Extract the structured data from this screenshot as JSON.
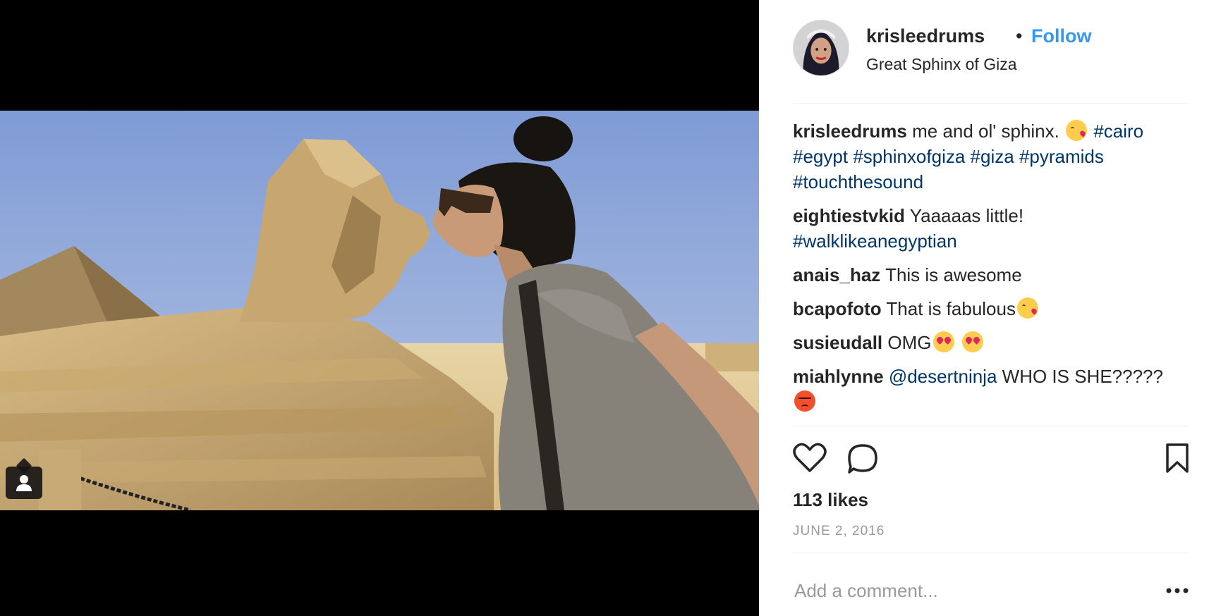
{
  "post": {
    "username": "krisleedrums",
    "separator": "•",
    "follow_label": "Follow",
    "location": "Great Sphinx of Giza",
    "likes": "113 likes",
    "date": "JUNE 2, 2016",
    "add_comment_placeholder": "Add a comment...",
    "photo_subject": "woman kissing the Great Sphinx with pyramid in background"
  },
  "caption": {
    "user": "krisleedrums",
    "text": "me and ol' sphinx.",
    "emoji": "kissing-face",
    "hashtags": [
      "#cairo",
      "#egypt",
      "#sphinxofgiza",
      "#giza",
      "#pyramids",
      "#touchthesound"
    ]
  },
  "comments": [
    {
      "user": "eightiestvkid",
      "text": "Yaaaaas little!",
      "hashtag": "#walklikeanegyptian"
    },
    {
      "user": "anais_haz",
      "text": "This is awesome"
    },
    {
      "user": "bcapofoto",
      "text": "That is fabulous",
      "emoji": "kissing-face"
    },
    {
      "user": "susieudall",
      "text": "OMG",
      "emoji": "heart-eyes-face x2"
    },
    {
      "user": "miahlynne",
      "mention": "@desertninja",
      "text": "WHO IS SHE?????",
      "emoji": "angry-face"
    }
  ],
  "icons": {
    "like": "heart-icon",
    "comment": "speech-bubble-icon",
    "save": "bookmark-icon",
    "more": "ellipsis-icon",
    "tag": "user-tag-icon"
  },
  "colors": {
    "follow": "#3897f0",
    "hashtag": "#003569",
    "text": "#262626",
    "muted": "#999999"
  }
}
